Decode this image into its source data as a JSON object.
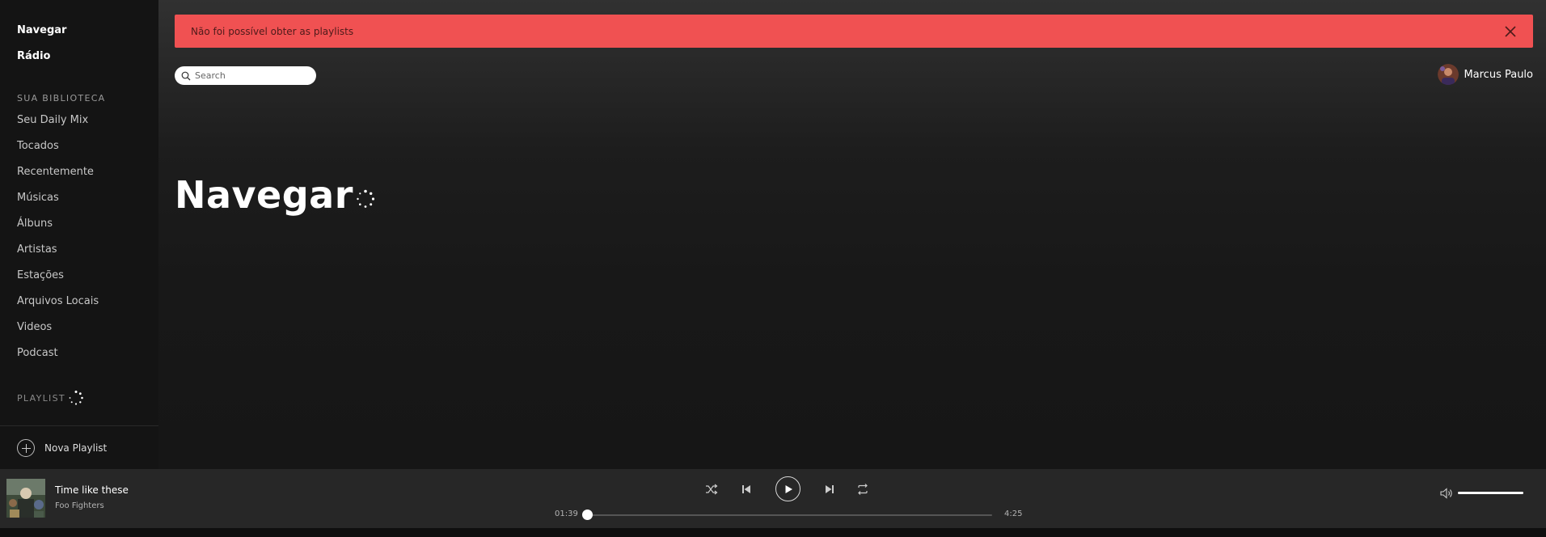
{
  "sidebar": {
    "nav": [
      {
        "label": "Navegar"
      },
      {
        "label": "Rádio"
      }
    ],
    "library_title": "SUA BIBLIOTECA",
    "library": [
      {
        "label": "Seu Daily Mix"
      },
      {
        "label": "Tocados"
      },
      {
        "label": "Recentemente"
      },
      {
        "label": "Músicas"
      },
      {
        "label": "Álbuns"
      },
      {
        "label": "Artistas"
      },
      {
        "label": "Estações"
      },
      {
        "label": "Arquivos Locais"
      },
      {
        "label": "Videos"
      },
      {
        "label": "Podcast"
      }
    ],
    "playlist_title": "PLAYLIST",
    "new_playlist_label": "Nova Playlist"
  },
  "alert": {
    "message": "Não foi possível obter as playlists",
    "close_icon": "close-icon"
  },
  "search": {
    "placeholder": "Search",
    "icon": "search-icon"
  },
  "user": {
    "name": "Marcus Paulo"
  },
  "main": {
    "title": "Navegar"
  },
  "player": {
    "track_title": "Time like these",
    "track_artist": "Foo Fighters",
    "elapsed": "01:39",
    "duration": "4:25",
    "progress_fraction": 0.0,
    "volume_fraction": 1.0,
    "controls": [
      "shuffle-icon",
      "previous-icon",
      "play-icon",
      "next-icon",
      "repeat-icon"
    ]
  },
  "colors": {
    "alert_bg": "#f05152",
    "sidebar_bg": "#141414",
    "player_bg": "#272727"
  }
}
